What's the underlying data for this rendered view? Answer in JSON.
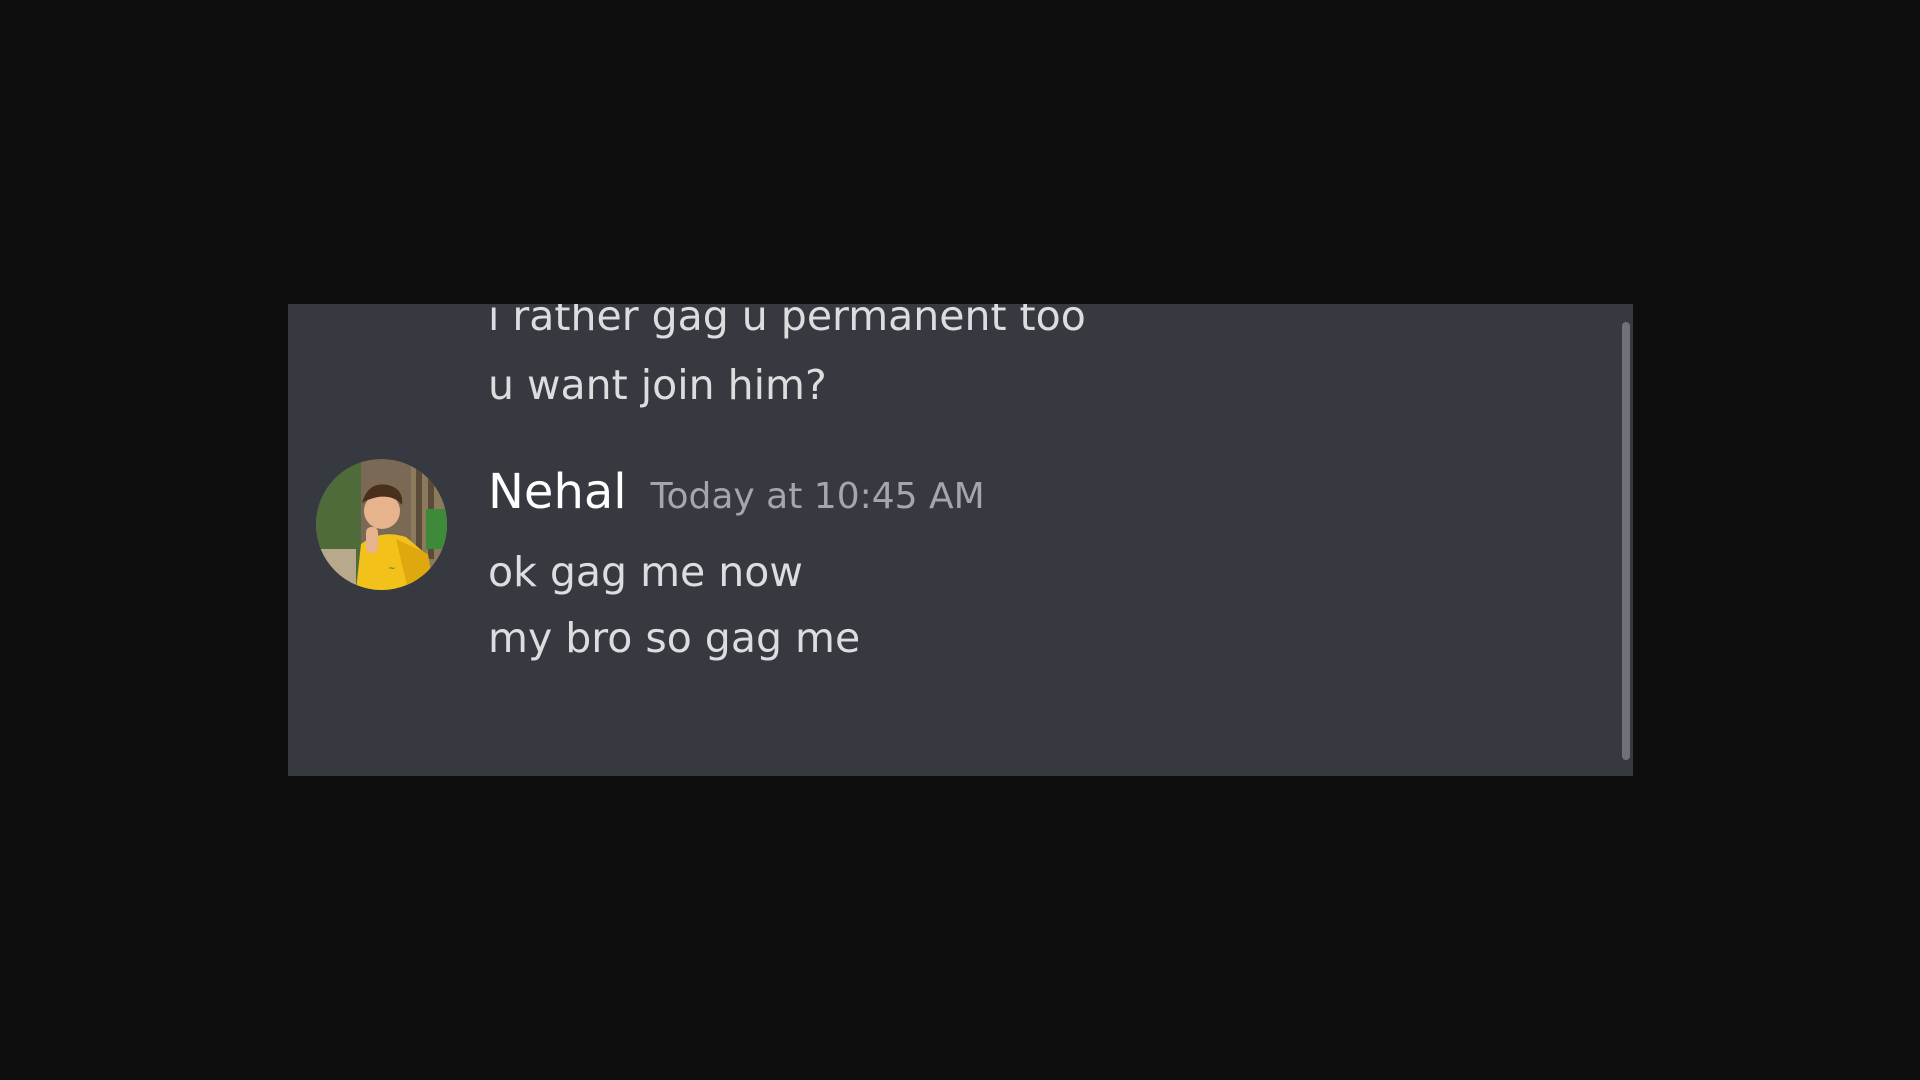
{
  "messages_above": [
    {
      "text": "i rather gag u permanent too"
    },
    {
      "text": "u want join him?"
    }
  ],
  "message_group": {
    "author": "Nehal",
    "timestamp": "Today at 10:45 AM",
    "lines": [
      {
        "text": "ok gag me now"
      },
      {
        "text": "my bro so gag me"
      }
    ],
    "avatar_icon": "user-avatar-photo"
  },
  "colors": {
    "background": "#0e0e0f",
    "panel": "#363940",
    "text": "#dcddde",
    "author": "#ffffff",
    "timestamp": "#a3a6aa"
  }
}
